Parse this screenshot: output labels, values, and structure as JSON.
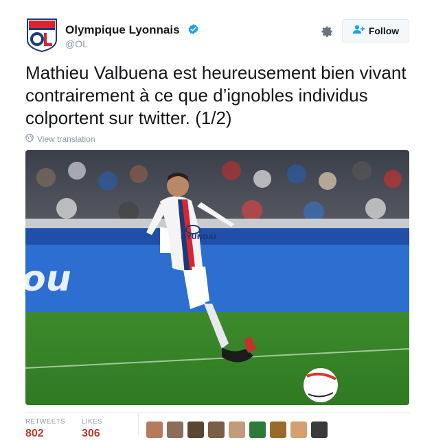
{
  "account": {
    "name": "Olympique Lyonnais",
    "handle": "@OL",
    "logo_text": "OL"
  },
  "actions": {
    "follow_label": "Follow"
  },
  "tweet": {
    "text": "Mathieu Valbuena est heureusement bien vivant contrairement à ce que d’ignobles individus colportent sur twitter. (1/2)",
    "translate_label": "View translation"
  },
  "stats": {
    "retweets_label": "RETWEETS",
    "retweets_value": "802",
    "likes_label": "LIKES",
    "likes_value": "306"
  },
  "colors": {
    "verified": "#1da1f2",
    "stat_value": "#c0392b",
    "muted": "#8899a6"
  },
  "icons": [
    "verified-badge-icon",
    "gear-icon",
    "follow-person-icon",
    "globe-icon"
  ]
}
